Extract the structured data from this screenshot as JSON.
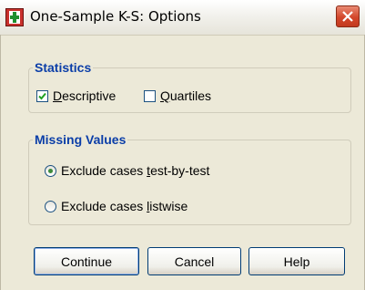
{
  "window": {
    "title": "One-Sample K-S: Options",
    "app_icon": "spss-dialog-icon",
    "close_icon": "close-icon"
  },
  "statistics": {
    "legend": "Statistics",
    "descriptive": {
      "label_pre": "",
      "mnemonic": "D",
      "label_post": "escriptive",
      "checked": true
    },
    "quartiles": {
      "label_pre": "",
      "mnemonic": "Q",
      "label_post": "uartiles",
      "checked": false
    }
  },
  "missing_values": {
    "legend": "Missing Values",
    "exclude_test": {
      "label_pre": "Exclude cases ",
      "mnemonic": "t",
      "label_post": "est-by-test",
      "selected": true
    },
    "exclude_listwise": {
      "label_pre": "Exclude cases ",
      "mnemonic": "l",
      "label_post": "istwise",
      "selected": false
    }
  },
  "buttons": {
    "continue": "Continue",
    "cancel": "Cancel",
    "help": "Help"
  },
  "colors": {
    "accent_legend": "#0b3ea8",
    "dialog_bg": "#ece9d8",
    "close_red": "#d3472b"
  }
}
